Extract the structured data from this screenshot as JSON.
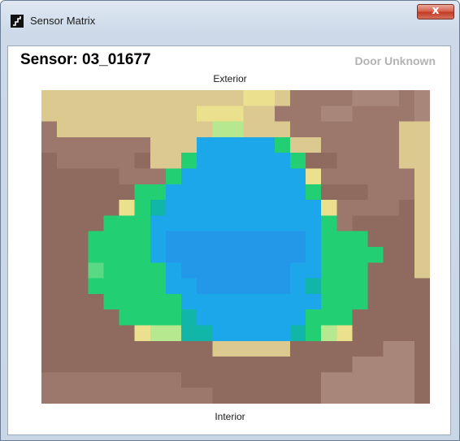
{
  "window": {
    "title": "Sensor Matrix",
    "close_label": "x"
  },
  "header": {
    "sensor_label": "Sensor: 03_01677",
    "door_status": "Door Unknown"
  },
  "matrix": {
    "top_label": "Exterior",
    "bottom_label": "Interior",
    "columns": 25,
    "rows": 20,
    "palette": {
      "A": "#8e6b5e",
      "B": "#9b786b",
      "C": "#a8877a",
      "D": "#84635a",
      "S": "#dcc98f",
      "Y": "#ebe08e",
      "L": "#b6e98f",
      "G": "#22cf72",
      "g": "#5ad985",
      "T": "#11b6a9",
      "b": "#1ba7e9",
      "c": "#2397e8"
    },
    "rows_data": [
      "SSSSSSSSSSSSSYYSBBBBCCCBC",
      "SSSSSSSSSSYYYSSBBBCCBBBBC",
      "BSSSSSSSSSSLLSSSBBBBBBBSS",
      "BBBBBBBSSSbbbbbGSSBBBBBSS",
      "ABBBBBASSGbbbbbbGAABBBBSS",
      "AAAAABBBGbbbbbbbbYBBBBBBS",
      "AAAAAAGGbbbbbbbbbGAAABBBS",
      "AAAAAYGTbbbbbbbbbbYBBBBAS",
      "AAAAGGGbbbbbbbbbbbGBAAAAS",
      "AAAGGGGbcccccccccbGGGAAAS",
      "AAAGGGGbcccccccccbGGGGAAS",
      "AAAgGGGGbcccccccbbGGGAAAS",
      "AAAGGGGGbbccccccbTGGGAAAA",
      "AAAAGGGGGbbbbbbbbbGGGAAAA",
      "AAAAAGGGGTbbbbbbbGGGAAAAA",
      "AAAAAAYLLTTbbbbbTGLYAAAAA",
      "AAAAAAAAAAASSSSSAAAAAACCA",
      "AAAAAAAAAAAAAAAAAAAACCCCA",
      "BBBBBBBBBAAAAAAAAACCCCCCA",
      "BBBBBBBBBBBAAAAAAACCCCCCA"
    ]
  }
}
